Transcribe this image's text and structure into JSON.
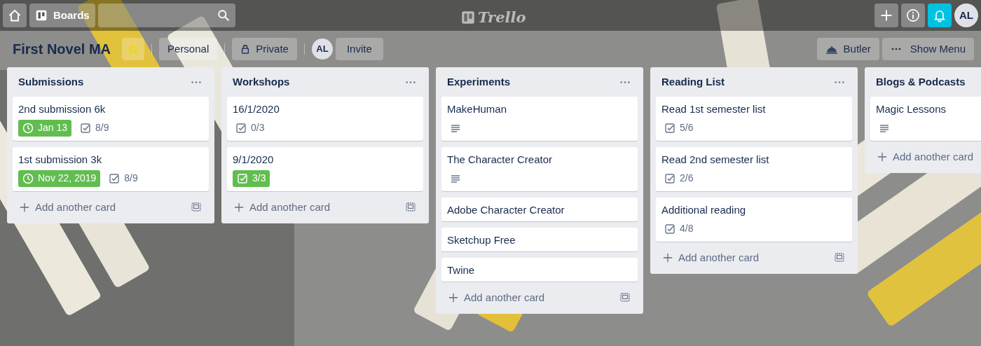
{
  "top_bar": {
    "boards_label": "Boards",
    "logo_text": "Trello",
    "notifications": {
      "active": true
    },
    "avatar": "AL"
  },
  "board": {
    "title": "First Novel MA",
    "starred": true,
    "team": "Personal",
    "visibility": "Private",
    "member_avatar": "AL",
    "invite": "Invite",
    "butler": "Butler",
    "menu": "Show Menu"
  },
  "lists": [
    {
      "title": "Submissions",
      "add_label": "Add another card",
      "cards": [
        {
          "title": "2nd submission 6k",
          "badges": [
            {
              "kind": "due",
              "text": "Jan 13",
              "complete": true
            },
            {
              "kind": "checklist",
              "text": "8/9",
              "complete": false
            }
          ]
        },
        {
          "title": "1st submission 3k",
          "badges": [
            {
              "kind": "due",
              "text": "Nov 22, 2019",
              "complete": true
            },
            {
              "kind": "checklist",
              "text": "8/9",
              "complete": false
            }
          ]
        }
      ]
    },
    {
      "title": "Workshops",
      "add_label": "Add another card",
      "cards": [
        {
          "title": "16/1/2020",
          "badges": [
            {
              "kind": "checklist",
              "text": "0/3",
              "complete": false
            }
          ]
        },
        {
          "title": "9/1/2020",
          "badges": [
            {
              "kind": "checklist",
              "text": "3/3",
              "complete": true
            }
          ]
        }
      ]
    },
    {
      "title": "Experiments",
      "add_label": "Add another card",
      "cards": [
        {
          "title": "MakeHuman",
          "badges": [
            {
              "kind": "description"
            }
          ]
        },
        {
          "title": "The Character Creator",
          "badges": [
            {
              "kind": "description"
            }
          ]
        },
        {
          "title": "Adobe Character Creator"
        },
        {
          "title": "Sketchup Free"
        },
        {
          "title": "Twine"
        }
      ]
    },
    {
      "title": "Reading List",
      "add_label": "Add another card",
      "cards": [
        {
          "title": "Read 1st semester list",
          "badges": [
            {
              "kind": "checklist",
              "text": "5/6",
              "complete": false
            }
          ]
        },
        {
          "title": "Read 2nd semester list",
          "badges": [
            {
              "kind": "checklist",
              "text": "2/6",
              "complete": false
            }
          ]
        },
        {
          "title": "Additional reading",
          "badges": [
            {
              "kind": "checklist",
              "text": "4/8",
              "complete": false
            }
          ]
        }
      ]
    },
    {
      "title": "Blogs & Podcasts",
      "cut_off": true,
      "add_label": "Add another card",
      "cards": [
        {
          "title": "Magic Lessons",
          "badges": [
            {
              "kind": "description"
            }
          ]
        }
      ]
    }
  ]
}
